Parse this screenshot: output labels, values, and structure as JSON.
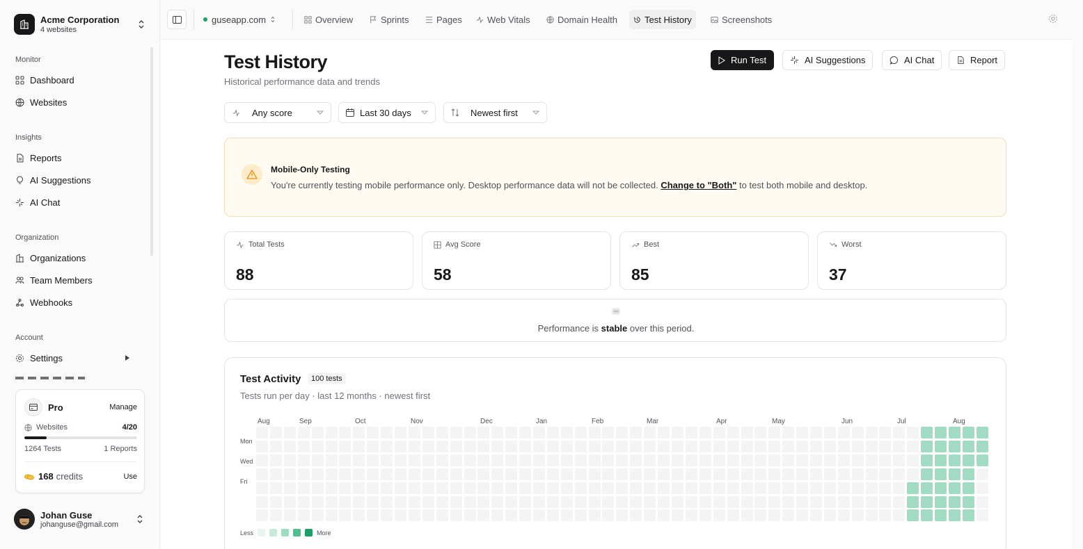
{
  "org": {
    "name": "Acme Corporation",
    "sub": "4 websites"
  },
  "sidebar": {
    "sections": [
      {
        "label": "Monitor",
        "items": [
          {
            "label": "Dashboard",
            "icon": "grid-icon"
          },
          {
            "label": "Websites",
            "icon": "globe-icon"
          }
        ]
      },
      {
        "label": "Insights",
        "items": [
          {
            "label": "Reports",
            "icon": "file-icon"
          },
          {
            "label": "AI Suggestions",
            "icon": "lightbulb-icon"
          },
          {
            "label": "AI Chat",
            "icon": "sparkles-icon"
          }
        ]
      },
      {
        "label": "Organization",
        "items": [
          {
            "label": "Organizations",
            "icon": "building-icon"
          },
          {
            "label": "Team Members",
            "icon": "users-icon"
          },
          {
            "label": "Webhooks",
            "icon": "webhook-icon"
          }
        ]
      },
      {
        "label": "Account",
        "items": [
          {
            "label": "Settings",
            "icon": "gear-icon"
          }
        ]
      }
    ]
  },
  "plan": {
    "name": "Pro",
    "manage": "Manage",
    "websites_label": "Websites",
    "websites_value": "4/20",
    "websites_fraction": 0.2,
    "tests": "1264 Tests",
    "reports": "1 Reports",
    "credits_value": "168",
    "credits_label": "credits",
    "use": "Use"
  },
  "user": {
    "name": "Johan Guse",
    "email": "johanguse@gmail.com"
  },
  "topbar": {
    "site": "guseapp.com",
    "tabs": [
      {
        "label": "Overview",
        "icon": "grid-icon"
      },
      {
        "label": "Sprints",
        "icon": "flag-icon"
      },
      {
        "label": "Pages",
        "icon": "list-icon"
      },
      {
        "label": "Web Vitals",
        "icon": "activity-icon"
      },
      {
        "label": "Domain Health",
        "icon": "globe-icon"
      },
      {
        "label": "Test History",
        "icon": "history-icon",
        "active": true
      },
      {
        "label": "Screenshots",
        "icon": "image-icon"
      }
    ]
  },
  "page": {
    "title": "Test History",
    "subtitle": "Historical performance data and trends",
    "buttons": {
      "run": "Run Test",
      "ai_suggestions": "AI Suggestions",
      "ai_chat": "AI Chat",
      "report": "Report"
    },
    "filters": {
      "score": "Any score",
      "range": "Last 30 days",
      "sort": "Newest first"
    }
  },
  "alert": {
    "title": "Mobile-Only Testing",
    "body_pre": "You're currently testing mobile performance only. Desktop performance data will not be collected. ",
    "link": "Change to \"Both\"",
    "body_post": " to test both mobile and desktop."
  },
  "stats": [
    {
      "label": "Total Tests",
      "value": "88",
      "icon": "activity-icon"
    },
    {
      "label": "Avg Score",
      "value": "58",
      "icon": "grid-icon"
    },
    {
      "label": "Best",
      "value": "85",
      "icon": "trending-up-icon"
    },
    {
      "label": "Worst",
      "value": "37",
      "icon": "trending-down-icon"
    }
  ],
  "trend": {
    "pre": "Performance is ",
    "strong": "stable",
    "post": " over this period."
  },
  "activity": {
    "title": "Test Activity",
    "badge": "100 tests",
    "subtitle": "Tests run per day · last 12 months · newest first",
    "months": [
      "Aug",
      "Sep",
      "Oct",
      "Nov",
      "Dec",
      "Jan",
      "Feb",
      "Mar",
      "Apr",
      "May",
      "Jun",
      "Jul",
      "Aug"
    ],
    "days": [
      "Mon",
      "Wed",
      "Fri"
    ],
    "legend_less": "Less",
    "legend_more": "More",
    "colors": {
      "empty": "#f4f4f5",
      "level": "#9fdcc1",
      "l1": "#e7f6ef",
      "l2": "#c6ebda",
      "l3": "#9fdcc1",
      "l4": "#4fbf8b",
      "l5": "#1f9e63",
      "accent": "#22a06b"
    }
  }
}
